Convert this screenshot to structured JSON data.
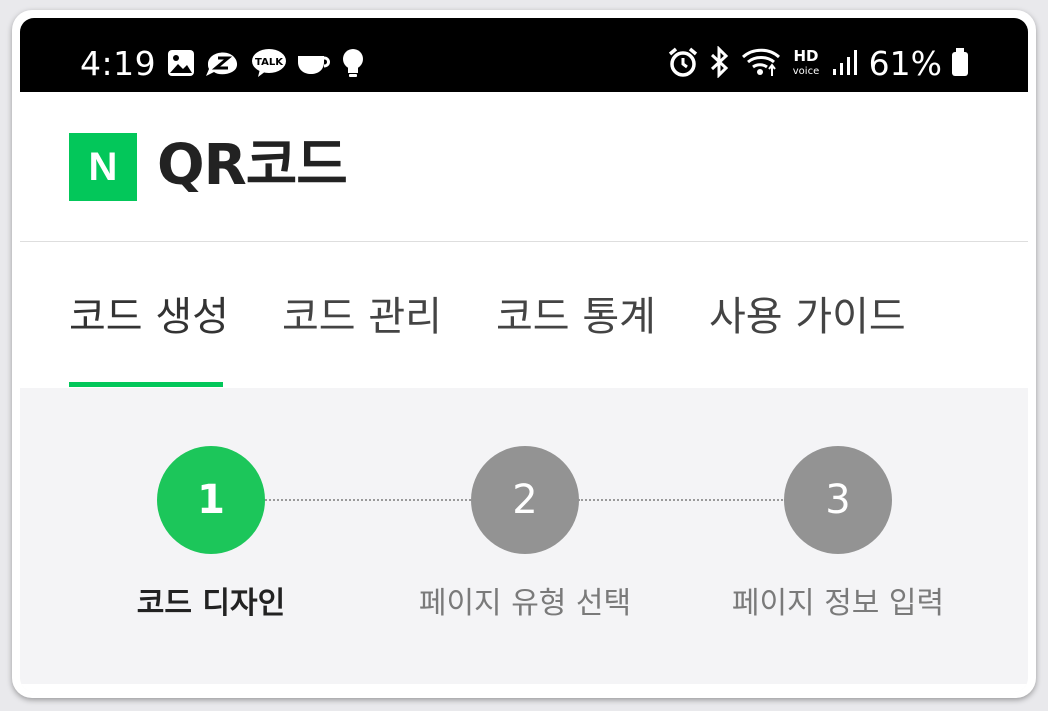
{
  "status_bar": {
    "time": "4:19",
    "battery": "61%",
    "left_icons": [
      "gallery-icon",
      "thread-icon",
      "kakaotalk-icon",
      "cup-icon",
      "bulb-icon"
    ],
    "talk_badge": "TALK",
    "hd_label": "HD",
    "voice_label": "voice"
  },
  "header": {
    "logo": "N",
    "title": "QR코드",
    "brand_color": "#03c75a"
  },
  "tabs": [
    {
      "label": "코드 생성",
      "active": true
    },
    {
      "label": "코드 관리",
      "active": false
    },
    {
      "label": "코드 통계",
      "active": false
    },
    {
      "label": "사용 가이드",
      "active": false
    }
  ],
  "steps": [
    {
      "number": "1",
      "label": "코드 디자인",
      "active": true
    },
    {
      "number": "2",
      "label": "페이지 유형 선택",
      "active": false
    },
    {
      "number": "3",
      "label": "페이지 정보 입력",
      "active": false
    }
  ],
  "colors": {
    "active_step": "#1cc65a",
    "inactive_step": "#939393",
    "tab_underline": "#03c75a"
  }
}
